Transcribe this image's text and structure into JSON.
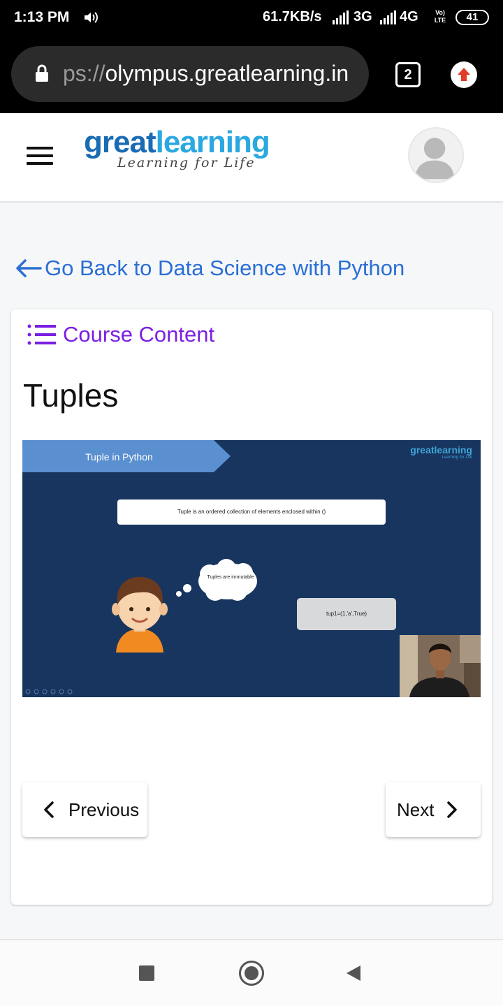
{
  "status_bar": {
    "time": "1:13 PM",
    "net_speed": "61.7KB/s",
    "network_1": "3G",
    "network_2": "4G",
    "volte": "Vo) LTE",
    "battery": "41"
  },
  "browser": {
    "url_faded": "ps://",
    "url_host": "olympus.greatlearning.in",
    "tab_count": "2"
  },
  "header": {
    "logo_part1": "great",
    "logo_part2": "learning",
    "tagline": "Learning for Life",
    "brand_colors": {
      "great": "#1a6bb5",
      "learning": "#2aa8e0"
    }
  },
  "back_link": {
    "label": "Go Back to Data Science with Python",
    "color": "#2a6fd6"
  },
  "course_content": {
    "label": "Course Content",
    "color": "#7b1fe3"
  },
  "lesson": {
    "title": "Tuples"
  },
  "video": {
    "slide_title": "Tuple in Python",
    "logo_part1": "great",
    "logo_part2": "learning",
    "logo_tagline": "Learning for Life",
    "definition": "Tuple is an ordered collection of elements enclosed within ()",
    "thought": "Tuples are immutable",
    "code": "tup1=(1,'a',True)"
  },
  "navigation": {
    "previous_label": "Previous",
    "next_label": "Next"
  }
}
